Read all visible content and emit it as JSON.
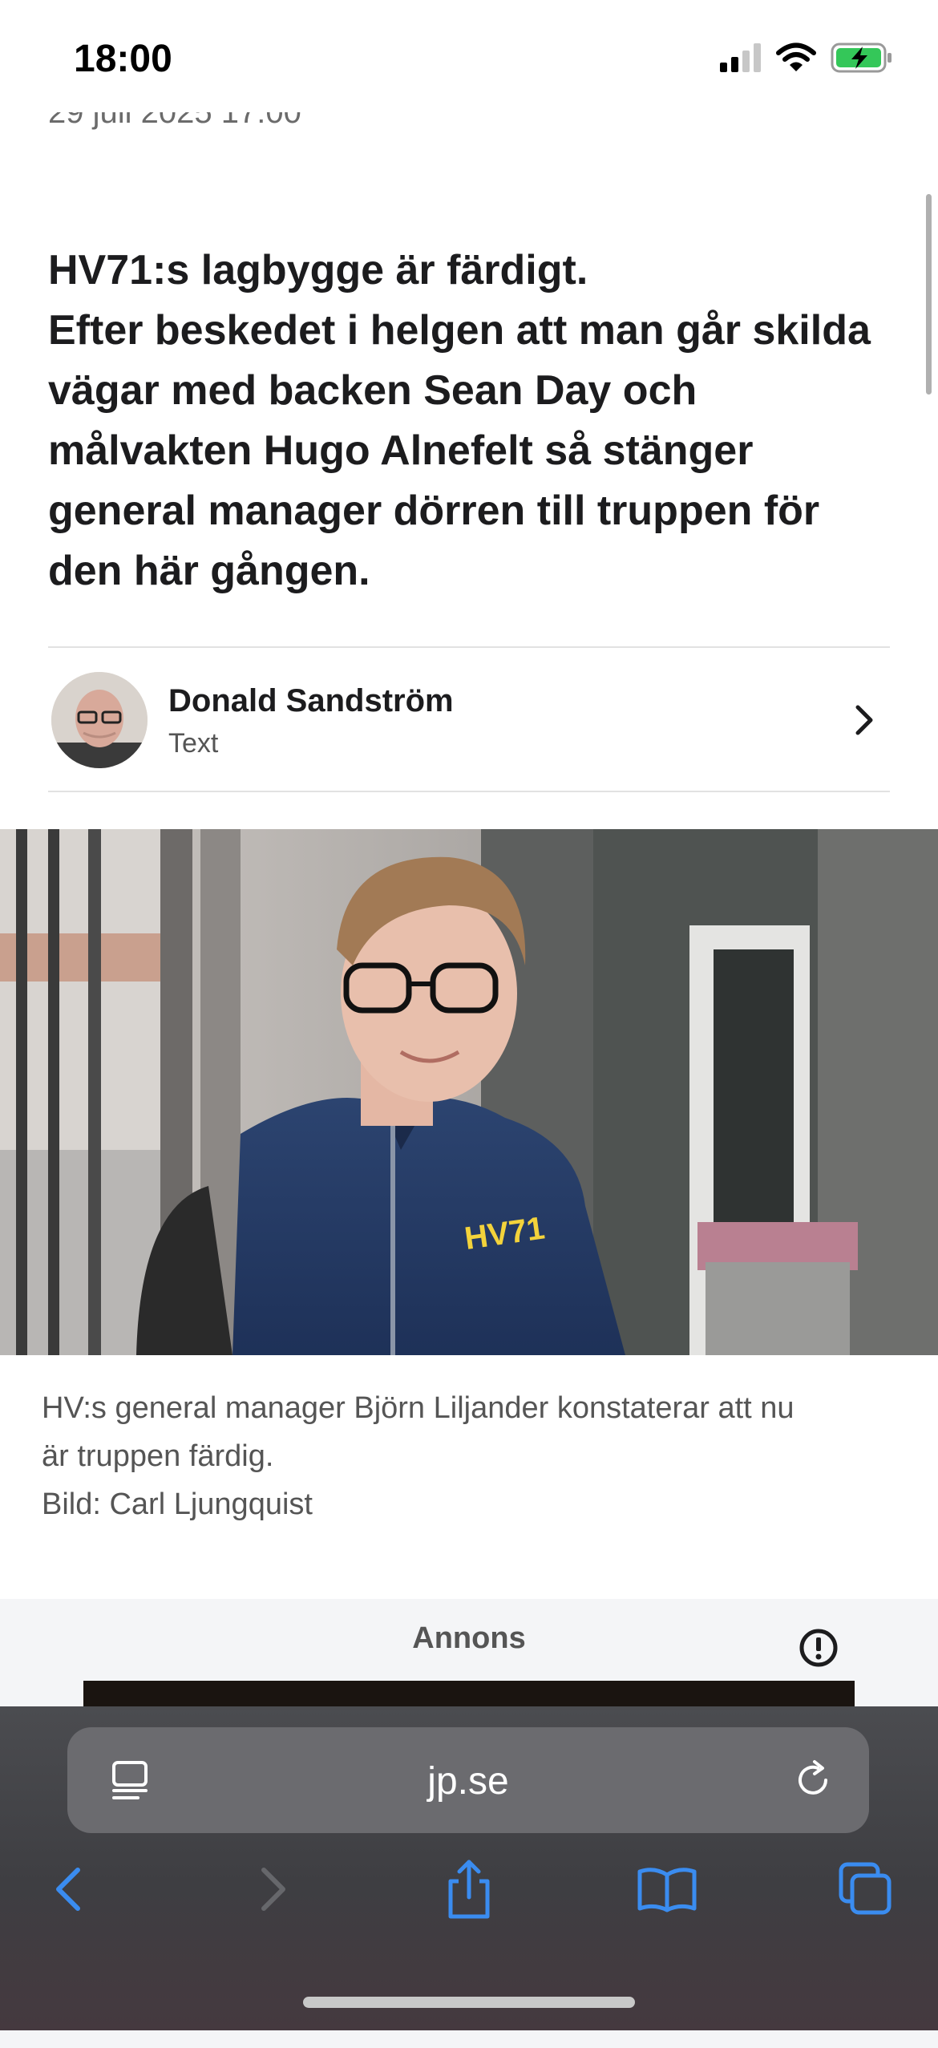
{
  "status_bar": {
    "time": "18:00",
    "battery_state": "charging"
  },
  "article": {
    "date": "29 juli 2025 17:00",
    "lead_lines": [
      "HV71:s lagbygge är färdigt.",
      "Efter beskedet i helgen att man går skilda",
      "vägar med backen Sean Day och",
      "målvakten Hugo Alnefelt så stänger",
      "general manager dörren till truppen för",
      "den här gången."
    ],
    "author": {
      "name": "Donald Sandström",
      "role": "Text"
    },
    "caption_lines": [
      "HV:s general manager Björn Liljander konstaterar att nu",
      "är truppen färdig.",
      "Bild: Carl Ljungquist"
    ],
    "hero_logo_text": "HV71"
  },
  "ad": {
    "label": "Annons"
  },
  "browser": {
    "url": "jp.se",
    "icons": [
      "reader-icon",
      "reload-icon",
      "back-icon",
      "forward-icon",
      "share-icon",
      "bookmarks-icon",
      "tabs-icon"
    ]
  },
  "colors": {
    "accent": "#3a8cf0",
    "toolbar": "#3f3f43",
    "text": "#1c1c1e",
    "muted": "#555555"
  }
}
